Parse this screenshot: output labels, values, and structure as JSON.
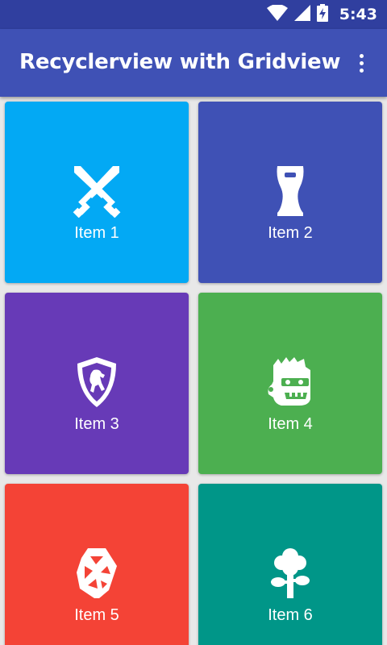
{
  "status_bar": {
    "time": "5:43",
    "icons": [
      "wifi-icon",
      "signal-icon",
      "battery-charging-icon"
    ],
    "color": "#303f9f"
  },
  "app_bar": {
    "title": "Recyclerview with Gridview",
    "overflow_icon": "more-vert-icon",
    "color": "#3f51b5"
  },
  "grid": {
    "items": [
      {
        "label": "Item 1",
        "icon": "crossed-swords-icon",
        "color": "#03a9f4"
      },
      {
        "label": "Item 2",
        "icon": "beer-glass-icon",
        "color": "#3f51b5"
      },
      {
        "label": "Item 3",
        "icon": "horse-shield-icon",
        "color": "#673ab7"
      },
      {
        "label": "Item 4",
        "icon": "zombie-face-icon",
        "color": "#4caf50"
      },
      {
        "label": "Item 5",
        "icon": "geometric-gem-icon",
        "color": "#f44336"
      },
      {
        "label": "Item 6",
        "icon": "tree-icon",
        "color": "#009688"
      }
    ]
  }
}
